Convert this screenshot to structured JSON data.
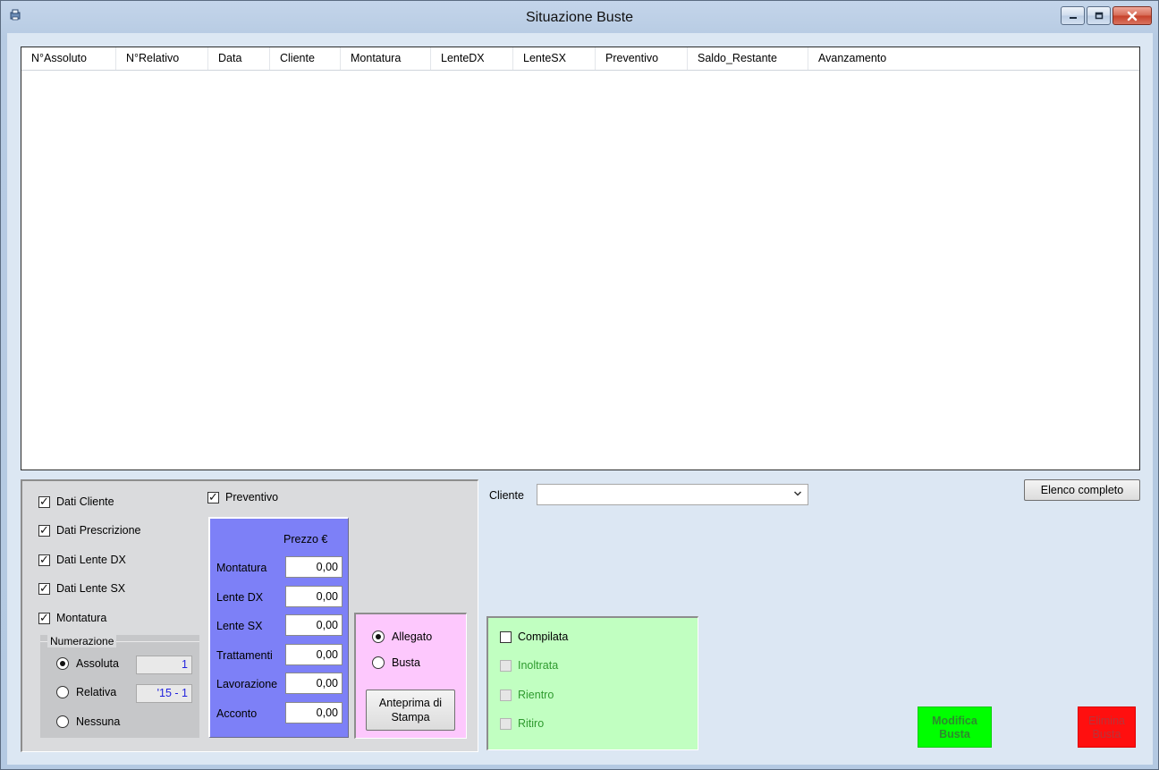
{
  "window": {
    "title": "Situazione Buste",
    "controls": {
      "minimize": "–",
      "maximize": "□",
      "close": "✕"
    }
  },
  "grid": {
    "columns": [
      "N°Assoluto",
      "N°Relativo",
      "Data",
      "Cliente",
      "Montatura",
      "LenteDX",
      "LenteSX",
      "Preventivo",
      "Saldo_Restante",
      "Avanzamento"
    ],
    "rows": []
  },
  "options": {
    "dati_cliente": {
      "label": "Dati Cliente",
      "checked": true
    },
    "dati_prescrizione": {
      "label": "Dati Prescrizione",
      "checked": true
    },
    "dati_lente_dx": {
      "label": "Dati Lente DX",
      "checked": true
    },
    "dati_lente_sx": {
      "label": "Dati Lente SX",
      "checked": true
    },
    "montatura": {
      "label": "Montatura",
      "checked": true
    },
    "preventivo": {
      "label": "Preventivo",
      "checked": true
    }
  },
  "numerazione": {
    "legend": "Numerazione",
    "assoluta": {
      "label": "Assoluta",
      "value": "1",
      "selected": true
    },
    "relativa": {
      "label": "Relativa",
      "value": "'15 - 1",
      "selected": false
    },
    "nessuna": {
      "label": "Nessuna",
      "selected": false
    }
  },
  "prezzo": {
    "header": "Prezzo €",
    "rows": [
      {
        "label": "Montatura",
        "value": "0,00"
      },
      {
        "label": "Lente DX",
        "value": "0,00"
      },
      {
        "label": "Lente SX",
        "value": "0,00"
      },
      {
        "label": "Trattamenti",
        "value": "0,00"
      },
      {
        "label": "Lavorazione",
        "value": "0,00"
      },
      {
        "label": "Acconto",
        "value": "0,00"
      }
    ]
  },
  "stampa": {
    "allegato": {
      "label": "Allegato",
      "selected": true
    },
    "busta": {
      "label": "Busta",
      "selected": false
    },
    "anteprima_line1": "Anteprima di",
    "anteprima_line2": "Stampa"
  },
  "stato": {
    "compilata": {
      "label": "Compilata",
      "checked": false
    },
    "inoltrata": {
      "label": "Inoltrata",
      "checked": false
    },
    "rientro": {
      "label": "Rientro",
      "checked": false
    },
    "ritiro": {
      "label": "Ritiro",
      "checked": false
    }
  },
  "filter": {
    "cliente_label": "Cliente",
    "cliente_value": "",
    "elenco_button": "Elenco completo"
  },
  "actions": {
    "modifica_line1": "Modifica",
    "modifica_line2": "Busta",
    "elimina_line1": "Elimina",
    "elimina_line2": "Busta"
  },
  "colors": {
    "prezzo_panel": "#7d80f7",
    "stampa_panel": "#fdc8fd",
    "stato_panel": "#c1ffc1",
    "modifica_button": "#00ff00",
    "elimina_button": "#ff0f0f"
  }
}
